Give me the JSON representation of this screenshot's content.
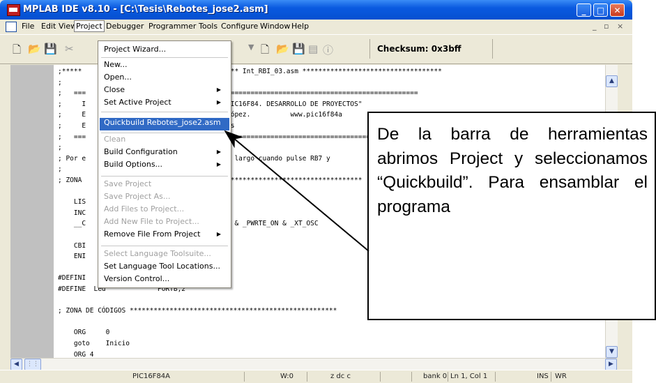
{
  "window": {
    "title": "MPLAB IDE v8.10 - [C:\\Tesis\\Rebotes_jose2.asm]",
    "icon": "mplab-app-icon"
  },
  "menubar": {
    "items": [
      "File",
      "Edit",
      "View",
      "Project",
      "Debugger",
      "Programmer",
      "Tools",
      "Configure",
      "Window",
      "Help"
    ],
    "active": "Project"
  },
  "toolbar": {
    "checksum": "Checksum: 0x3bff"
  },
  "project_menu": {
    "items": [
      {
        "label": "Project Wizard...",
        "enabled": true
      },
      {
        "label": "New...",
        "enabled": true
      },
      {
        "label": "Open...",
        "enabled": true
      },
      {
        "label": "Close",
        "enabled": true,
        "submenu": true
      },
      {
        "label": "Set Active Project",
        "enabled": true,
        "submenu": true
      },
      {
        "label": "Quickbuild Rebotes_jose2.asm",
        "enabled": true,
        "highlighted": true
      },
      {
        "label": "Clean",
        "enabled": false
      },
      {
        "label": "Build Configuration",
        "enabled": true,
        "submenu": true
      },
      {
        "label": "Build Options...",
        "enabled": true,
        "submenu": true
      },
      {
        "label": "Save Project",
        "enabled": false
      },
      {
        "label": "Save Project As...",
        "enabled": false
      },
      {
        "label": "Add Files to Project...",
        "enabled": false
      },
      {
        "label": "Add New File to Project...",
        "enabled": false
      },
      {
        "label": "Remove File From Project",
        "enabled": true,
        "submenu": true
      },
      {
        "label": "Select Language Toolsuite...",
        "enabled": false
      },
      {
        "label": "Set Language Tool Locations...",
        "enabled": true
      },
      {
        "label": "Version Control...",
        "enabled": true
      }
    ]
  },
  "editor": {
    "lines": [
      ";*****",
      ";",
      ";   ===",
      ";     I",
      ";     E",
      ";     E",
      ";   ===",
      ";",
      "; Por e",
      ";",
      "; ZONA",
      "",
      "    LIS",
      "    INC",
      "    __C",
      "",
      "    CBI",
      "    ENI",
      "",
      "#DEFINI",
      "#DEFINE  Led             PORTB,2",
      "",
      "; ZONA DE CÓDIGOS ****************************************************",
      "",
      "    ORG     0",
      "    goto    Inicio",
      "    ORG 4"
    ],
    "right_fragments": [
      {
        "line": 0,
        "text": "*** Int_RBI_03.asm ***********************************"
      },
      {
        "line": 2,
        "text": "================================================"
      },
      {
        "line": 3,
        "text": "PIC16F84. DESARROLLO DE PROYECTOS\""
      },
      {
        "line": 4,
        "text": "López.          www.pic16f84a"
      },
      {
        "line": 5,
        "text": "es"
      },
      {
        "line": 6,
        "text": "================================================"
      },
      {
        "line": 8,
        "text": "o largo cuando pulse RB7 y"
      },
      {
        "line": 10,
        "text": "**********************************"
      },
      {
        "line": 14,
        "text": "F & _PWRTE_ON & _XT_OSC"
      }
    ]
  },
  "statusbar": {
    "processor": "PIC16F84A",
    "w": "W:0",
    "flags": "z dc c",
    "bank": "bank 0",
    "position": "Ln 1, Col 1",
    "ins": "INS",
    "wr": "WR"
  },
  "callout": {
    "text": "De la barra de herramientas abrimos Project y seleccionamos “Quickbuild”. Para ensamblar el programa"
  },
  "colors": {
    "title_blue": "#0a5ae0",
    "menu_highlight": "#316ac5",
    "chrome": "#ece9d8"
  }
}
